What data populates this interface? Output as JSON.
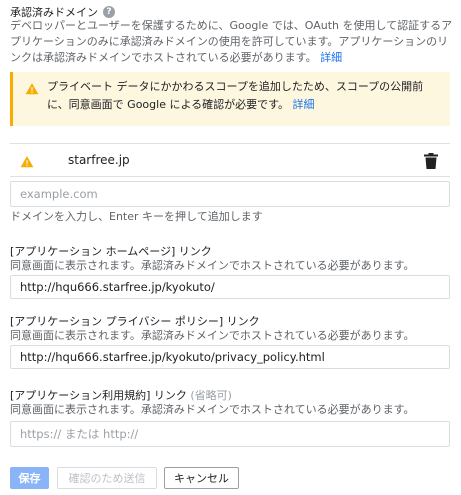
{
  "header": {
    "title": "承認済みドメイン",
    "description": "デベロッパーとユーザーを保護するために、Google では、OAuth を使用して認証するアプリケーションのみに承認済みドメインの使用を許可しています。アプリケーションのリンクは承認済みドメインでホストされている必要があります。",
    "details_link": "詳細"
  },
  "warning": {
    "text": "プライベート データにかかわるスコープを追加したため、スコープの公開前に、同意画面で Google による確認が必要です。",
    "details_link": "詳細"
  },
  "domains": [
    {
      "name": "starfree.jp"
    }
  ],
  "new_domain": {
    "placeholder": "example.com",
    "help": "ドメインを入力し、Enter キーを押して追加します"
  },
  "homepage": {
    "label": "[アプリケーション ホームページ] リンク",
    "help": "同意画面に表示されます。承認済みドメインでホストされている必要があります。",
    "value": "http://hqu666.starfree.jp/kyokuto/"
  },
  "privacy": {
    "label": "[アプリケーション プライバシー ポリシー] リンク",
    "help": "同意画面に表示されます。承認済みドメインでホストされている必要があります。",
    "value": "http://hqu666.starfree.jp/kyokuto/privacy_policy.html"
  },
  "terms": {
    "label": "[アプリケーション利用規約] リンク",
    "optional": "(省略可)",
    "help": "同意画面に表示されます。承認済みドメインでホストされている必要があります。",
    "placeholder": "https:// または http://"
  },
  "buttons": {
    "save": "保存",
    "submit": "確認のため送信",
    "cancel": "キャンセル"
  },
  "colors": {
    "link": "#1a73e8",
    "warning": "#f9ab00",
    "warning_bg": "#fef7e0",
    "save_button": "#8ab4f8"
  }
}
